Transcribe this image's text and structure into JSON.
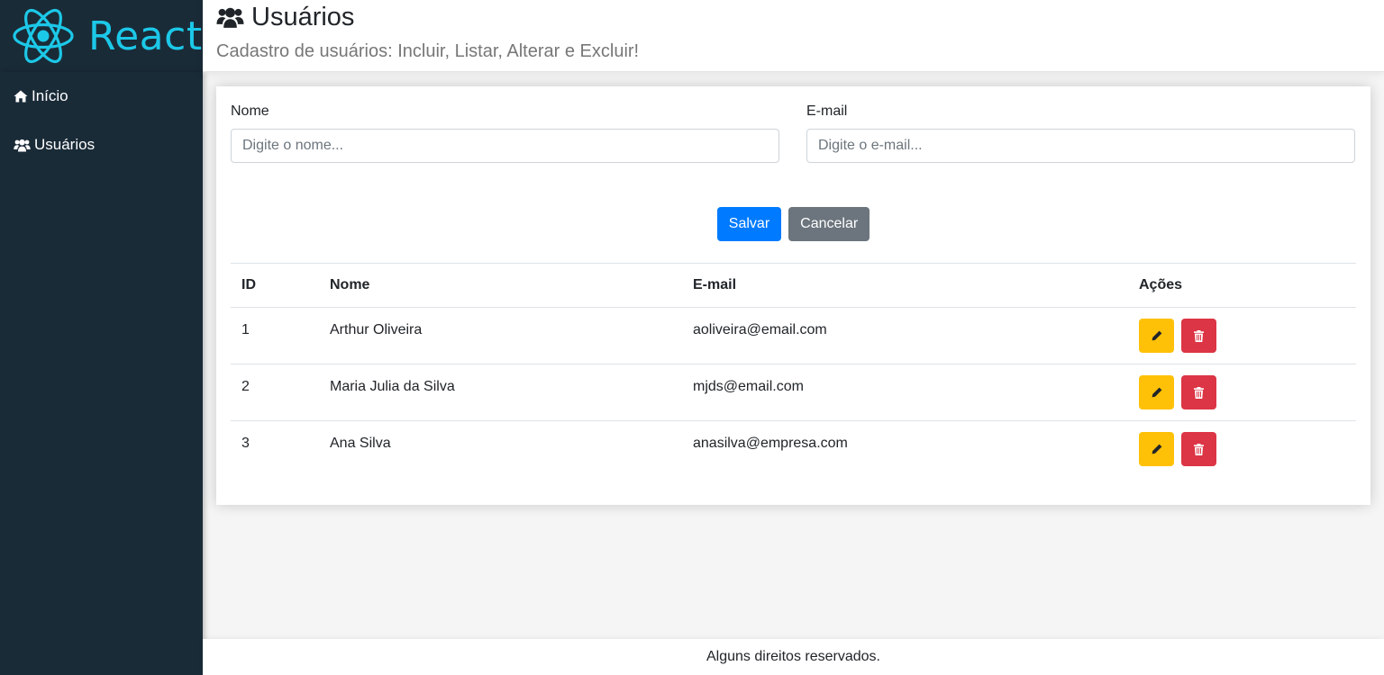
{
  "brand": {
    "name": "React",
    "color": "#1cc8e8",
    "icon": "react-atom-icon"
  },
  "sidebar": {
    "items": [
      {
        "label": "Início",
        "icon": "home-icon"
      },
      {
        "label": "Usuários",
        "icon": "users-icon"
      }
    ]
  },
  "header": {
    "title": "Usuários",
    "title_icon": "users-icon",
    "subtitle": "Cadastro de usuários: Incluir, Listar, Alterar e Excluir!"
  },
  "form": {
    "name_label": "Nome",
    "name_placeholder": "Digite o nome...",
    "name_value": "",
    "email_label": "E-mail",
    "email_placeholder": "Digite o e-mail...",
    "email_value": "",
    "save_label": "Salvar",
    "cancel_label": "Cancelar"
  },
  "table": {
    "headers": [
      "ID",
      "Nome",
      "E-mail",
      "Ações"
    ],
    "rows": [
      {
        "id": "1",
        "name": "Arthur Oliveira",
        "email": "aoliveira@email.com"
      },
      {
        "id": "2",
        "name": "Maria Julia da Silva",
        "email": "mjds@email.com"
      },
      {
        "id": "3",
        "name": "Ana Silva",
        "email": "anasilva@empresa.com"
      }
    ],
    "edit_icon": "pencil-icon",
    "delete_icon": "trash-icon"
  },
  "footer": {
    "text": "Alguns direitos reservados."
  },
  "colors": {
    "sidebar_bg": "#1a2b38",
    "primary": "#007bff",
    "secondary": "#6c757d",
    "warning": "#ffc107",
    "danger": "#dc3545"
  }
}
